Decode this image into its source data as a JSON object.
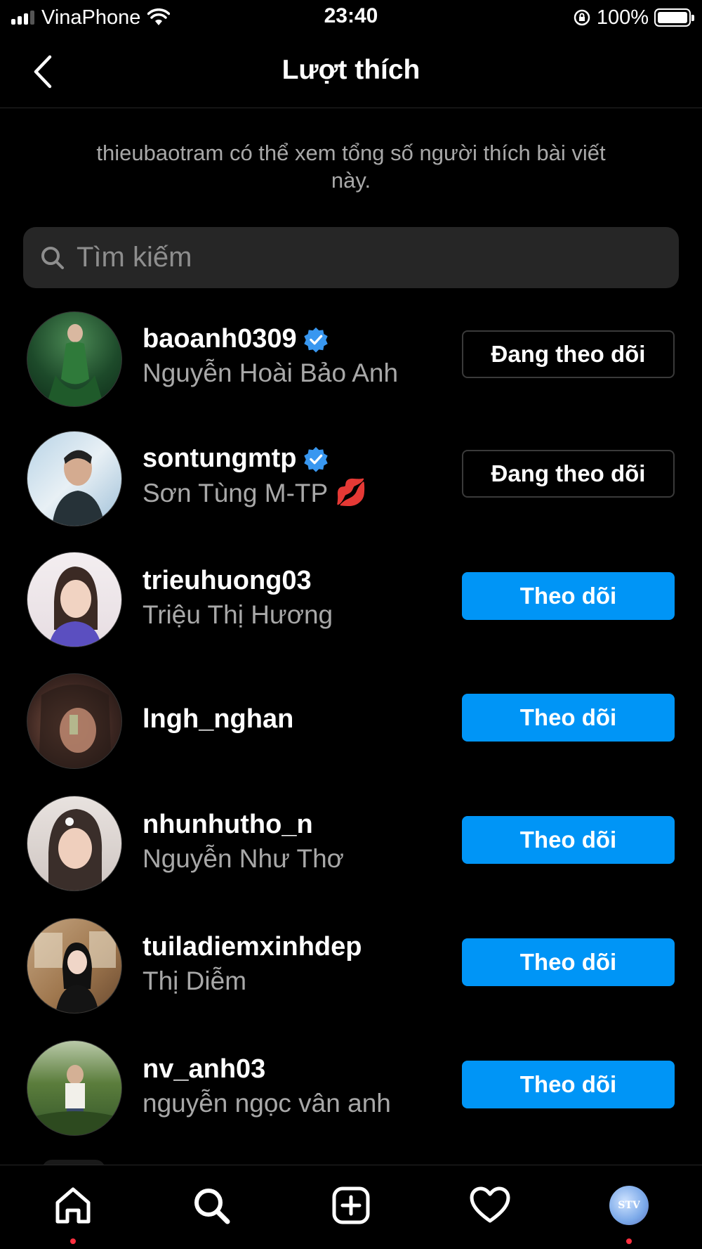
{
  "status_bar": {
    "carrier": "VinaPhone",
    "time": "23:40",
    "battery": "100%"
  },
  "header": {
    "title": "Lượt thích"
  },
  "notice": "thieubaotram có thể xem tổng số người thích bài viết này.",
  "search": {
    "placeholder": "Tìm kiếm"
  },
  "users": [
    {
      "username": "baoanh0309",
      "full_name": "Nguyễn Hoài Bảo Anh",
      "verified": true,
      "button": "Đang theo dõi",
      "following": true
    },
    {
      "username": "sontungmtp",
      "full_name": "Sơn Tùng M-TP",
      "verified": true,
      "button": "Đang theo dõi",
      "following": true,
      "emoji": "💋"
    },
    {
      "username": "trieuhuong03",
      "full_name": "Triệu Thị Hương",
      "verified": false,
      "button": "Theo dõi",
      "following": false
    },
    {
      "username": "lngh_nghan",
      "full_name": "",
      "verified": false,
      "button": "Theo dõi",
      "following": false
    },
    {
      "username": "nhunhutho_n",
      "full_name": "Nguyễn Như Thơ",
      "verified": false,
      "button": "Theo dõi",
      "following": false
    },
    {
      "username": "tuiladiemxinhdep",
      "full_name": "Thị Diễm",
      "verified": false,
      "button": "Theo dõi",
      "following": false
    },
    {
      "username": "nv_anh03",
      "full_name": "nguyễn ngọc vân anh",
      "verified": false,
      "button": "Theo dõi",
      "following": false
    }
  ],
  "bottom_nav": {
    "profile_initials": "STV",
    "items": [
      "home-icon",
      "search-icon",
      "new-post-icon",
      "activity-heart-icon",
      "profile-avatar"
    ]
  }
}
